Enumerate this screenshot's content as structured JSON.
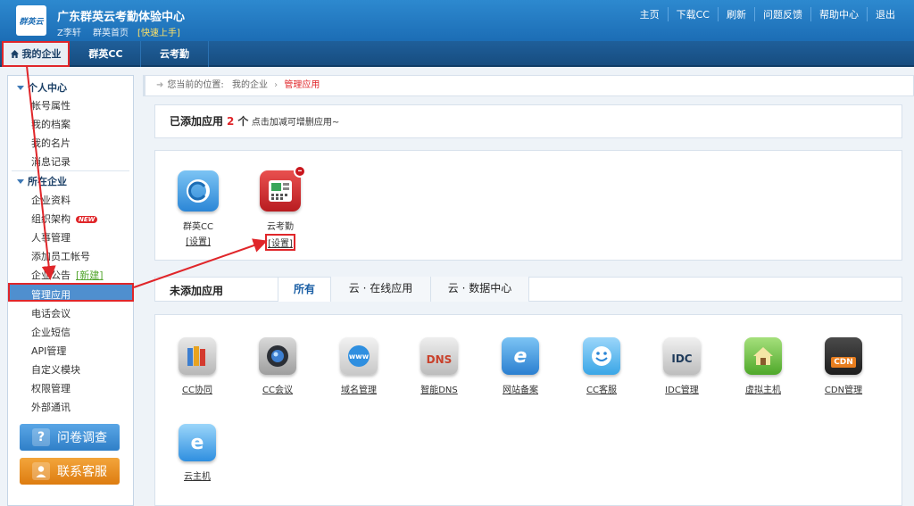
{
  "header": {
    "logo_text": "群英云",
    "title": "广东群英云考勤体验中心",
    "user_name": "Z李轩",
    "home_link": "群英首页",
    "quick_start": "[快速上手]",
    "nav": [
      "主页",
      "下载CC",
      "刷新",
      "问题反馈",
      "帮助中心",
      "退出"
    ]
  },
  "tabs": {
    "my_enterprise": "我的企业",
    "qunying_cc": "群英CC",
    "cloud_attendance": "云考勤"
  },
  "sidebar": {
    "section_personal": "个人中心",
    "personal_items": [
      "帐号属性",
      "我的档案",
      "我的名片",
      "消息记录"
    ],
    "section_enterprise": "所在企业",
    "enterprise_items": [
      "企业资料",
      "组织架构",
      "人事管理",
      "添加员工帐号",
      "企业公告",
      "管理应用",
      "电话会议",
      "企业短信",
      "API管理",
      "自定义模块",
      "权限管理",
      "外部通讯"
    ],
    "new_badge": "NEW",
    "new_link": "[新建]",
    "survey_button": "问卷调查",
    "service_button": "联系客服"
  },
  "breadcrumb": {
    "prefix": "您当前的位置:",
    "level1": "我的企业",
    "current": "管理应用"
  },
  "added": {
    "title": "已添加应用",
    "count": "2",
    "unit": "个",
    "hint": "点击加减可增删应用~",
    "apps": [
      {
        "name": "群英CC",
        "link": "[设置]",
        "icon": "qunying-cc-icon",
        "color": "#3b9be0"
      },
      {
        "name": "云考勤",
        "link": "[设置]",
        "icon": "attendance-machine-icon",
        "color": "#d6252a"
      }
    ]
  },
  "not_added": {
    "title": "未添加应用",
    "tabs": [
      "所有",
      "云 · 在线应用",
      "云 · 数据中心"
    ],
    "apps": [
      {
        "name": "CC协同",
        "icon_text": "",
        "icon": "books-icon",
        "color": "#5b8fd6"
      },
      {
        "name": "CC会议",
        "icon_text": "",
        "icon": "webcam-icon",
        "color": "#3b4a5a"
      },
      {
        "name": "域名管理",
        "icon_text": "www",
        "icon": "globe-icon",
        "color": "#2f8fe0"
      },
      {
        "name": "智能DNS",
        "icon_text": "DNS",
        "icon": "dns-icon",
        "color": "#c9412b"
      },
      {
        "name": "网站备案",
        "icon_text": "e",
        "icon": "browser-icon",
        "color": "#2f7fd6"
      },
      {
        "name": "CC客服",
        "icon_text": "",
        "icon": "smiley-icon",
        "color": "#3aa6e6"
      },
      {
        "name": "IDC管理",
        "icon_text": "IDC",
        "icon": "idc-icon",
        "color": "#6d7a86"
      },
      {
        "name": "虚拟主机",
        "icon_text": "",
        "icon": "house-icon",
        "color": "#5cb534"
      },
      {
        "name": "CDN管理",
        "icon_text": "CDN",
        "icon": "cdn-gauge-icon",
        "color": "#e87e1f"
      },
      {
        "name": "云主机",
        "icon_text": "e",
        "icon": "cloud-host-icon",
        "color": "#2f8fe0"
      }
    ]
  }
}
